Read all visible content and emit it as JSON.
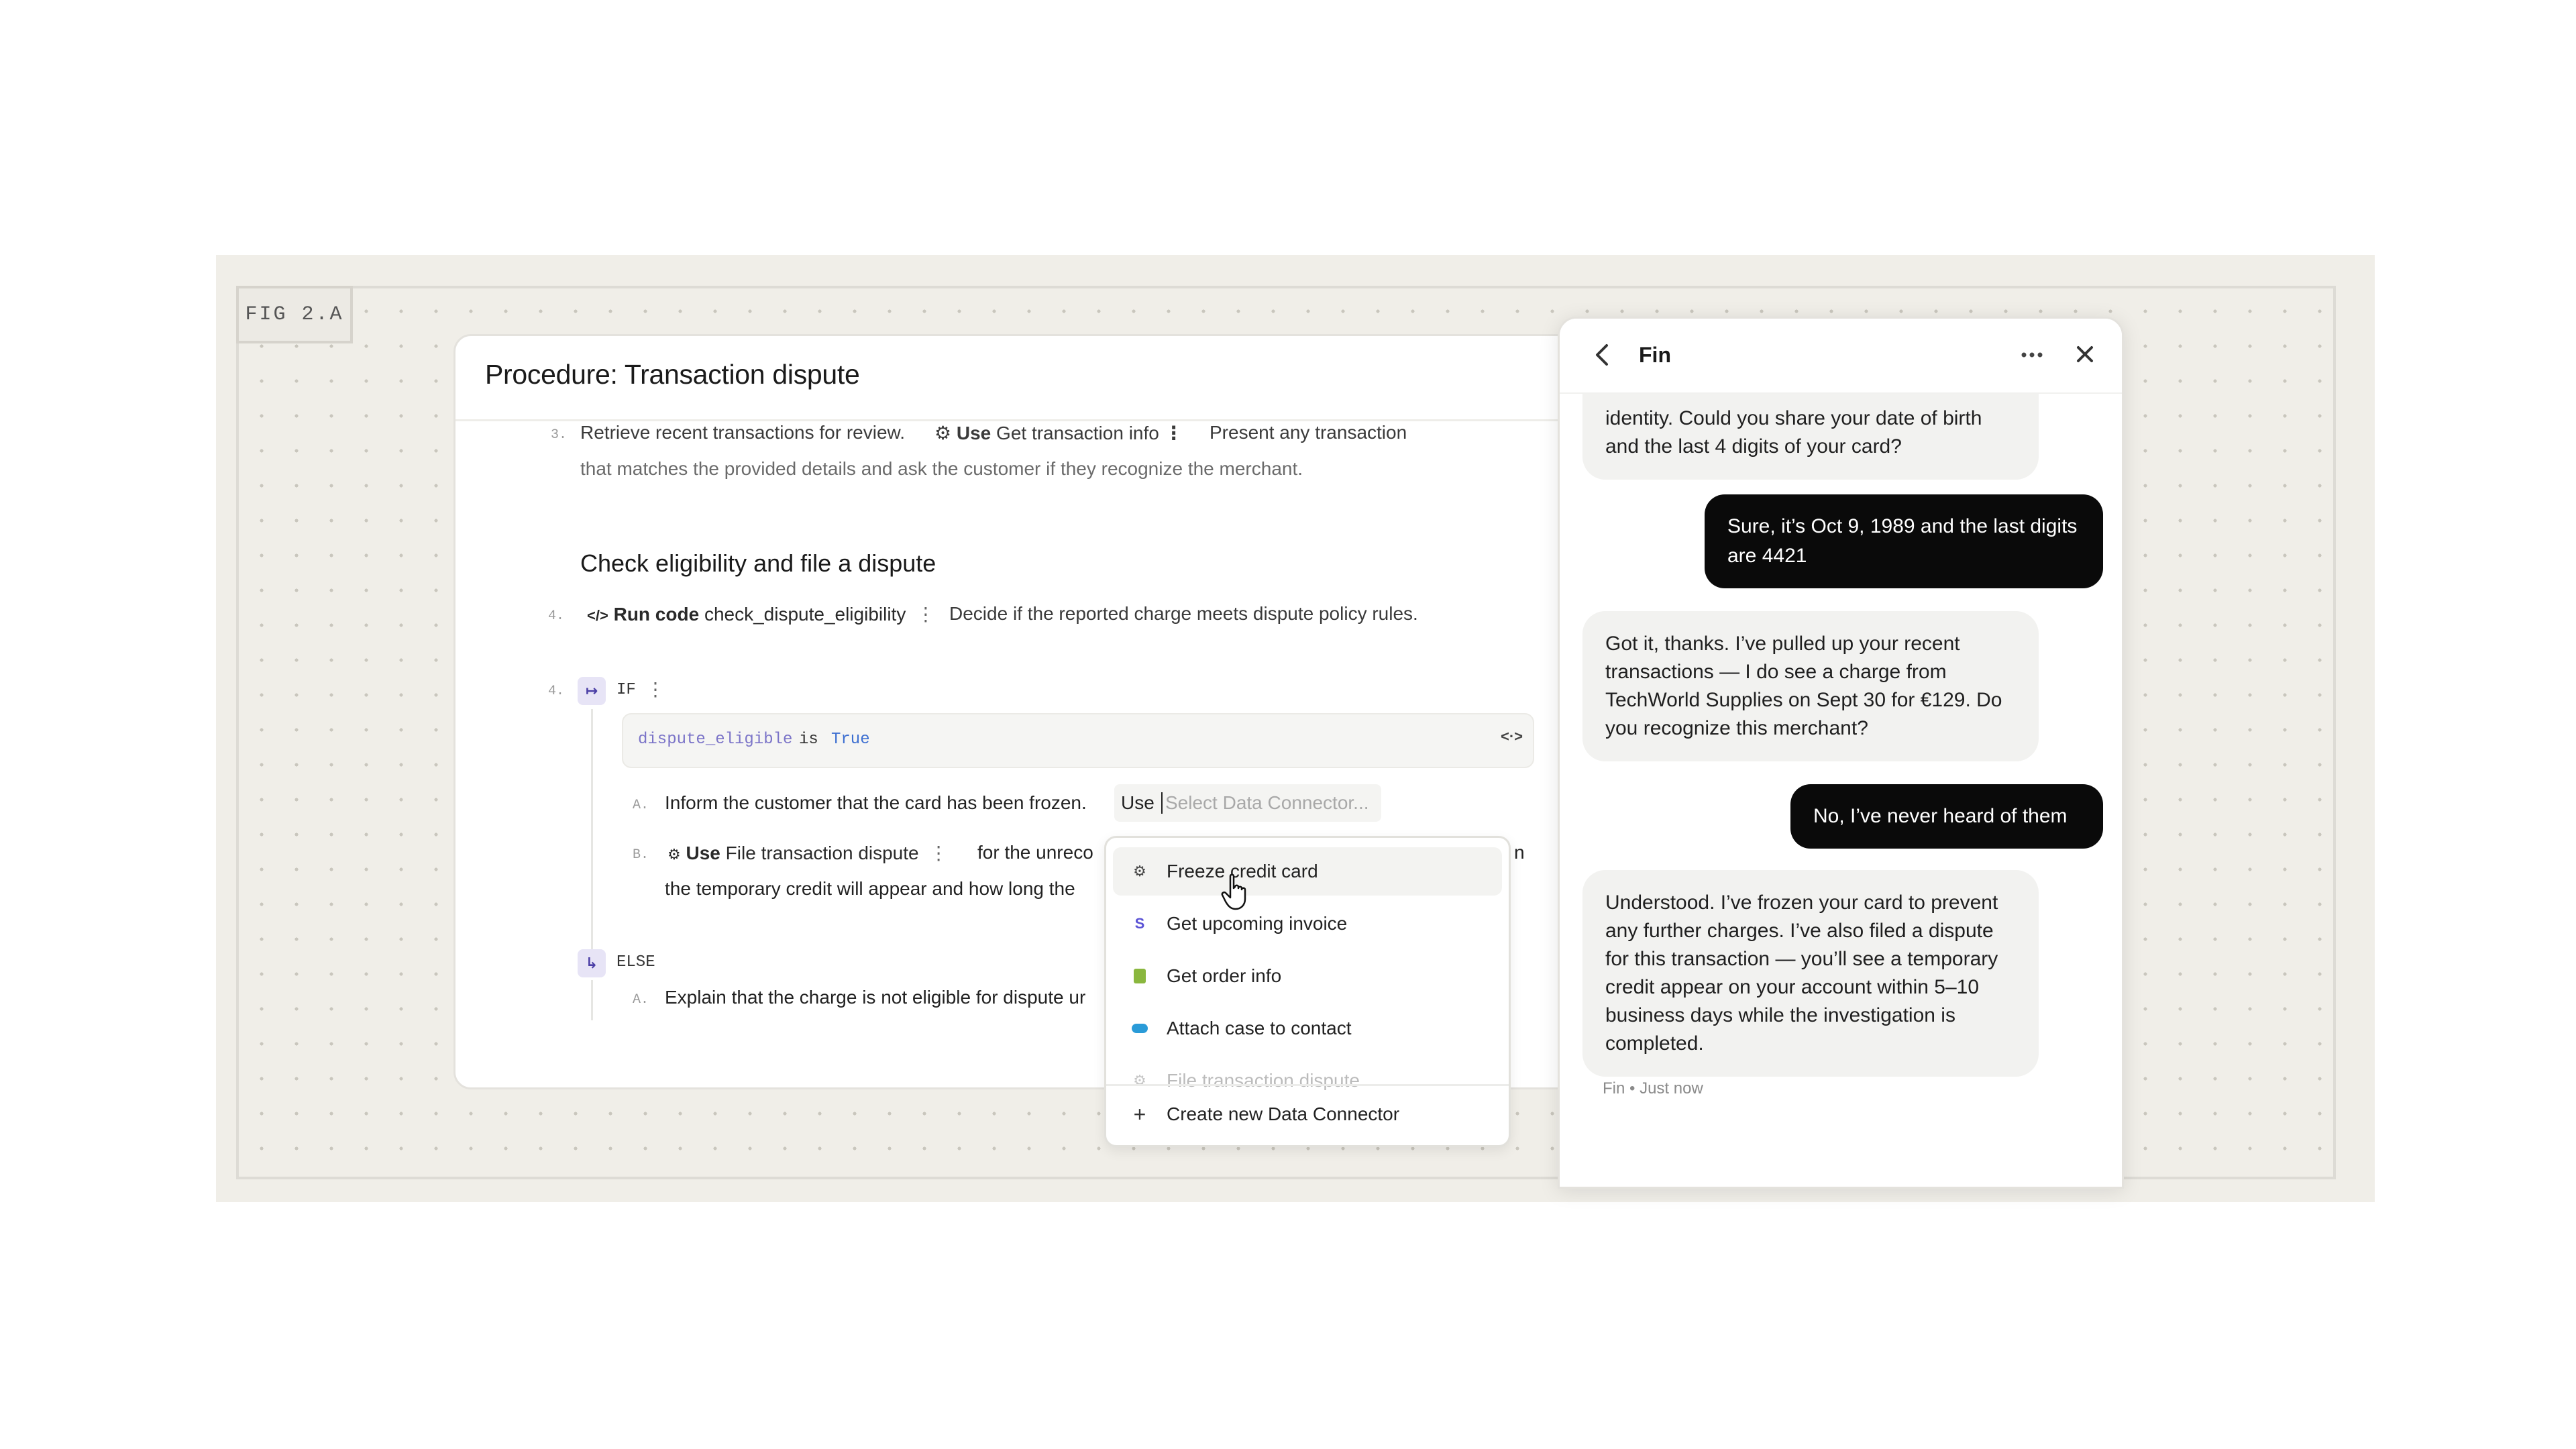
{
  "figure": {
    "label": "FIG 2.A"
  },
  "procedure": {
    "title": "Procedure: Transaction dispute",
    "step3": {
      "line1_start": "Retrieve recent transactions for review.",
      "chip_use": "Use",
      "chip_name": "Get transaction info",
      "line1_end": "Present any transaction",
      "line2": "that matches the provided details and ask the customer if they recognize the merchant."
    },
    "section_title": "Check eligibility and file a dispute",
    "step4a": {
      "number": "4.",
      "chip_bold": "Run code",
      "chip_name": "check_dispute_eligibility",
      "text": "Decide if the reported charge meets dispute policy rules."
    },
    "step4b": {
      "number": "4.",
      "if_label": "IF",
      "condition_var": "dispute_eligible",
      "condition_op": "is",
      "condition_val": "True",
      "sub_a": {
        "letter": "A.",
        "text": "Inform the customer that the card has been frozen.",
        "use": "Use",
        "placeholder": "Select Data Connector..."
      },
      "sub_b": {
        "letter": "B.",
        "chip_bold": "Use",
        "chip_name": "File transaction dispute",
        "text_visible": "for the unreco",
        "line2": "the temporary credit will appear and how long the",
        "tail": "n"
      },
      "else_label": "ELSE",
      "else_a": {
        "letter": "A.",
        "text": "Explain that the charge is not eligible for dispute ur"
      }
    }
  },
  "dropdown": {
    "items": [
      {
        "label": "Freeze credit card",
        "icon": "connector-icon"
      },
      {
        "label": "Get upcoming invoice",
        "icon": "stripe-icon"
      },
      {
        "label": "Get order info",
        "icon": "shopify-icon"
      },
      {
        "label": "Attach case to contact",
        "icon": "salesforce-icon"
      },
      {
        "label": "File transaction dispute",
        "icon": "connector-icon"
      }
    ],
    "create_label": "Create new Data Connector"
  },
  "chat": {
    "title": "Fin",
    "messages": [
      {
        "from": "bot",
        "text": "identity. Could you share your date of birth and the last 4 digits of your card?"
      },
      {
        "from": "user",
        "text": "Sure, it’s Oct 9, 1989 and the last digits are 4421"
      },
      {
        "from": "bot",
        "text": "Got it, thanks. I’ve pulled up your recent transactions — I do see a charge from TechWorld Supplies on Sept 30 for €129. Do you recognize this merchant?"
      },
      {
        "from": "user",
        "text": "No, I’ve never heard of them"
      },
      {
        "from": "bot",
        "text": "Understood. I’ve frozen your card to prevent any further charges. I’ve also filed a dispute for this transaction — you’ll see a temporary credit appear on your account within 5–10 business days while the investigation is completed."
      }
    ],
    "meta": "Fin • Just now"
  }
}
